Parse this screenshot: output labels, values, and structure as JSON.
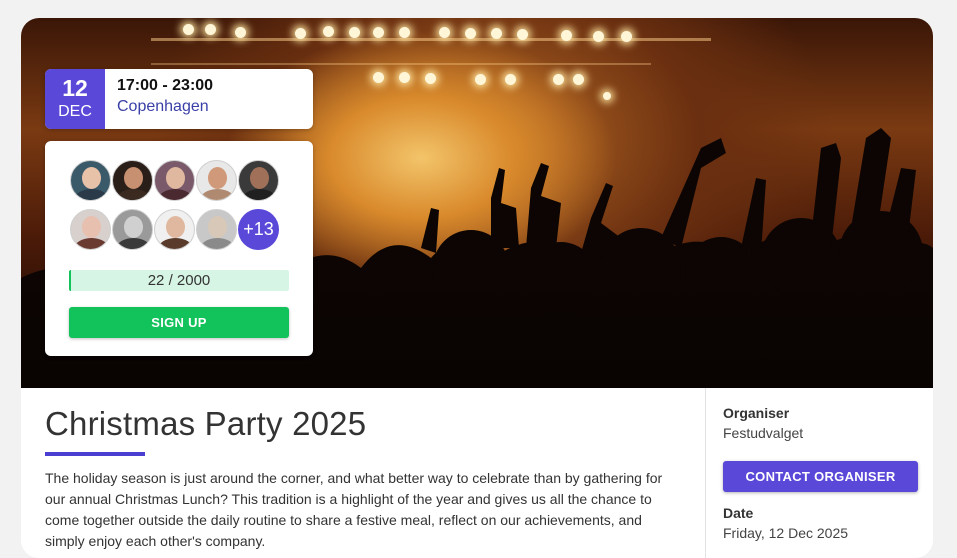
{
  "event": {
    "day": "12",
    "month": "DEC",
    "time": "17:00 - 23:00",
    "city": "Copenhagen",
    "title": "Christmas Party 2025",
    "description": "The holiday season is just around the corner, and what better way to celebrate than by gathering for our annual Christmas Lunch? This tradition is a highlight of the year and gives us all the chance to come together outside the daily routine to share a festive meal, reflect on our achievements, and simply enjoy each other's company."
  },
  "attendees": {
    "more_label": "+13",
    "progress_text": "22 / 2000",
    "progress_fraction": 0.011,
    "signup_label": "SIGN UP"
  },
  "organiser": {
    "label": "Organiser",
    "name": "Festudvalget",
    "contact_label": "CONTACT ORGANISER",
    "date_label": "Date",
    "date_value": "Friday, 12 Dec 2025"
  },
  "colors": {
    "accent": "#5a48d8",
    "signup": "#12c25a",
    "progress_bg": "#d7f5e4"
  }
}
